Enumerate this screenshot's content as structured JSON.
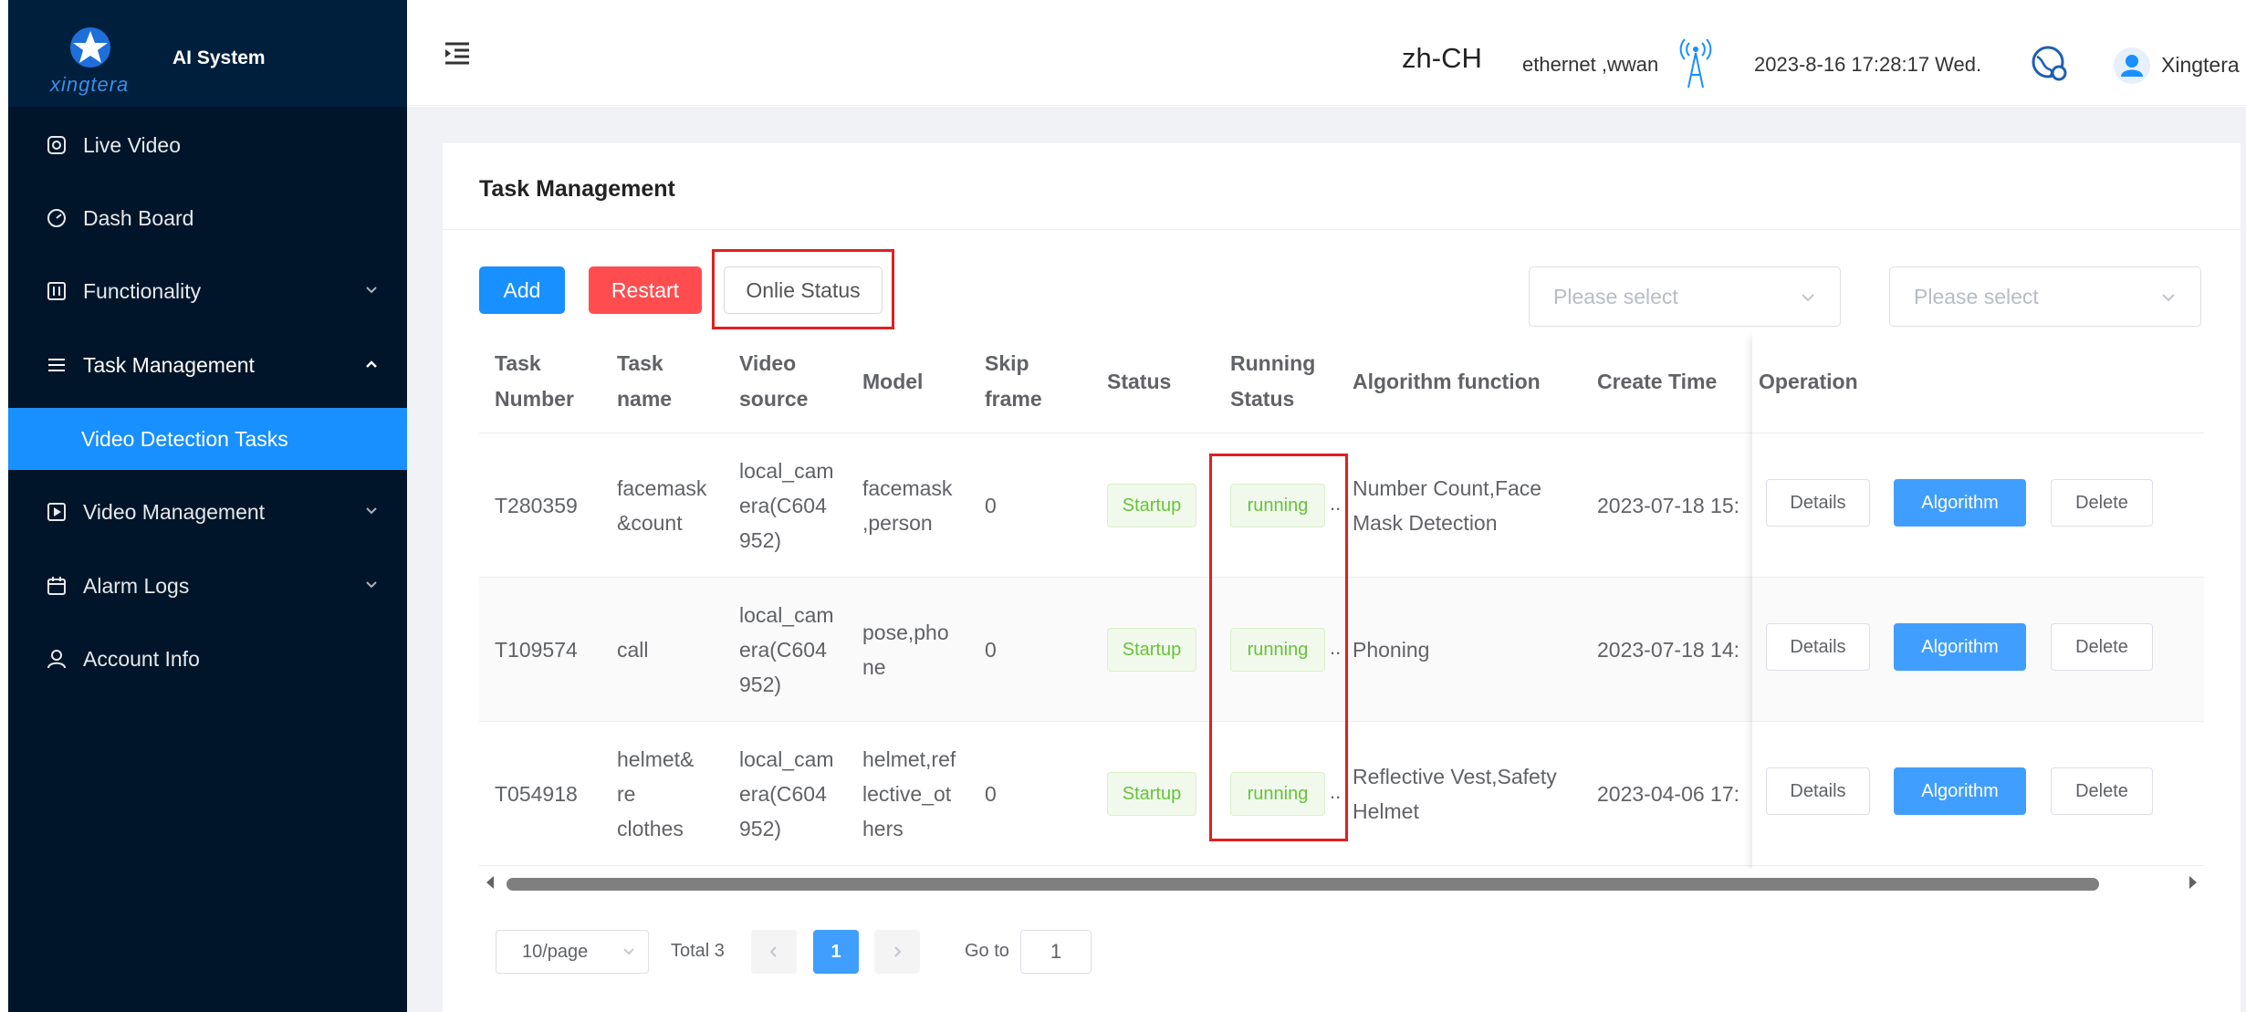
{
  "sidebar": {
    "brand": "AI System",
    "logo_text": "xingtera",
    "items": [
      {
        "label": "Live Video",
        "icon": "camera-icon"
      },
      {
        "label": "Dash Board",
        "icon": "dashboard-icon"
      },
      {
        "label": "Functionality",
        "icon": "functionality-icon"
      },
      {
        "label": "Task Management",
        "icon": "list-icon"
      },
      {
        "label": "Video Detection Tasks"
      },
      {
        "label": "Video Management",
        "icon": "video-icon"
      },
      {
        "label": "Alarm Logs",
        "icon": "calendar-icon"
      },
      {
        "label": "Account Info",
        "icon": "user-icon"
      }
    ]
  },
  "header": {
    "language": "zh-CH",
    "network": "ethernet ,wwan",
    "datetime": "2023-8-16 17:28:17 Wed.",
    "username": "Xingtera"
  },
  "page": {
    "title": "Task Management",
    "buttons": {
      "add": "Add",
      "restart": "Restart",
      "online_status": "Onlie Status"
    },
    "filters": [
      {
        "placeholder": "Please select"
      },
      {
        "placeholder": "Please select"
      }
    ]
  },
  "table": {
    "columns": {
      "task_number": "Task Number",
      "task_name": "Task name",
      "video_source": "Video source",
      "model": "Model",
      "skip_frame": "Skip frame",
      "status": "Status",
      "running_status": "Running Status",
      "algorithm_function": "Algorithm function",
      "create_time": "Create Time",
      "operation": "Operation"
    },
    "rows": [
      {
        "task_number": "T280359",
        "task_name": "facemask &count",
        "video_source": "local_camera(C604952)",
        "model": "facemask ,person",
        "skip_frame": "0",
        "status": "Startup",
        "running_status": "running",
        "algorithm_function": "Number Count,Face Mask Detection",
        "create_time": "2023-07-18 15:"
      },
      {
        "task_number": "T109574",
        "task_name": "call",
        "video_source": "local_camera(C604952)",
        "model": "pose,phone",
        "skip_frame": "0",
        "status": "Startup",
        "running_status": "running",
        "algorithm_function": "Phoning",
        "create_time": "2023-07-18 14:"
      },
      {
        "task_number": "T054918",
        "task_name": "helmet& re clothes",
        "video_source": "local_camera(C604952)",
        "model": "helmet,reflective_others",
        "skip_frame": "0",
        "status": "Startup",
        "running_status": "running",
        "algorithm_function": "Reflective Vest,Safety Helmet",
        "create_time": "2023-04-06 17:"
      }
    ],
    "operations": {
      "details": "Details",
      "algorithm": "Algorithm",
      "delete": "Delete"
    }
  },
  "pagination": {
    "page_size": "10/page",
    "total": "Total 3",
    "current_page": "1",
    "goto_label": "Go to",
    "goto_value": "1"
  }
}
